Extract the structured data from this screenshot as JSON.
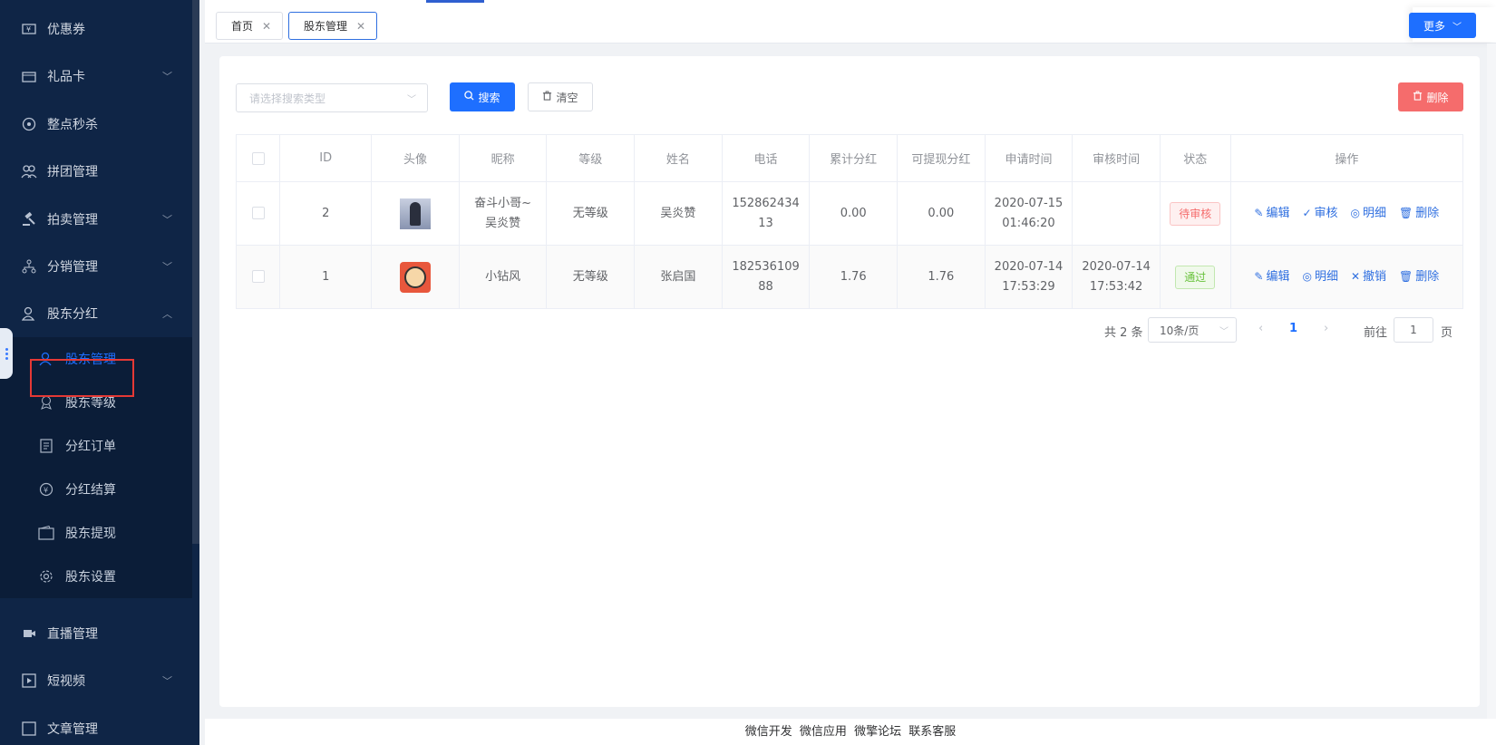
{
  "sidebar": {
    "items": [
      {
        "label": "优惠券",
        "icon": "coupon-icon",
        "arrow": ""
      },
      {
        "label": "礼品卡",
        "icon": "gift-card-icon",
        "arrow": "﹀"
      },
      {
        "label": "整点秒杀",
        "icon": "flash-sale-icon",
        "arrow": ""
      },
      {
        "label": "拼团管理",
        "icon": "group-icon",
        "arrow": ""
      },
      {
        "label": "拍卖管理",
        "icon": "auction-icon",
        "arrow": "﹀"
      },
      {
        "label": "分销管理",
        "icon": "distribution-icon",
        "arrow": "﹀"
      },
      {
        "label": "股东分红",
        "icon": "shareholder-dividend-icon",
        "arrow": "︿"
      }
    ],
    "sub_items": [
      {
        "label": "股东管理",
        "icon": "user-icon"
      },
      {
        "label": "股东等级",
        "icon": "level-icon"
      },
      {
        "label": "分红订单",
        "icon": "order-icon"
      },
      {
        "label": "分红结算",
        "icon": "settlement-icon"
      },
      {
        "label": "股东提现",
        "icon": "wallet-icon"
      },
      {
        "label": "股东设置",
        "icon": "settings-icon"
      }
    ],
    "bottom_items": [
      {
        "label": "直播管理",
        "icon": "live-icon",
        "arrow": ""
      },
      {
        "label": "短视频",
        "icon": "video-icon",
        "arrow": "﹀"
      },
      {
        "label": "文章管理",
        "icon": "article-icon",
        "arrow": ""
      }
    ]
  },
  "tabs": [
    {
      "label": "首页"
    },
    {
      "label": "股东管理"
    }
  ],
  "more_label": "更多",
  "toolbar": {
    "search_type_placeholder": "请选择搜索类型",
    "search_label": "搜索",
    "clear_label": "清空",
    "delete_label": "删除"
  },
  "table": {
    "columns": [
      "ID",
      "头像",
      "昵称",
      "等级",
      "姓名",
      "电话",
      "累计分红",
      "可提现分红",
      "申请时间",
      "审核时间",
      "状态",
      "操作"
    ],
    "rows": [
      {
        "id": "2",
        "nickname_line1": "奋斗小哥~",
        "nickname_line2": "吴炎赞",
        "level": "无等级",
        "name": "吴炎赞",
        "phone_line1": "152862434",
        "phone_line2": "13",
        "total_dividend": "0.00",
        "withdrawable": "0.00",
        "apply_date": "2020-07-15",
        "apply_time": "01:46:20",
        "review_date": "",
        "review_time": "",
        "status": "待审核",
        "ops": [
          "编辑",
          "审核",
          "明细",
          "删除"
        ]
      },
      {
        "id": "1",
        "nickname_line1": "小钻风",
        "nickname_line2": "",
        "level": "无等级",
        "name": "张启国",
        "phone_line1": "182536109",
        "phone_line2": "88",
        "total_dividend": "1.76",
        "withdrawable": "1.76",
        "apply_date": "2020-07-14",
        "apply_time": "17:53:29",
        "review_date": "2020-07-14",
        "review_time": "17:53:42",
        "status": "通过",
        "ops": [
          "编辑",
          "明细",
          "撤销",
          "删除"
        ]
      }
    ]
  },
  "pagination": {
    "total": "共 2 条",
    "page_size": "10条/页",
    "current": "1",
    "goto_label": "前往",
    "goto_value": "1",
    "page_suffix": "页"
  },
  "footer": {
    "links": [
      "微信开发",
      "微信应用",
      "微擎论坛",
      "联系客服"
    ]
  },
  "colors": {
    "sidebar_bg": "#0f2546",
    "primary": "#1e6fff",
    "danger": "#f56c6c",
    "success": "#67c23a"
  }
}
